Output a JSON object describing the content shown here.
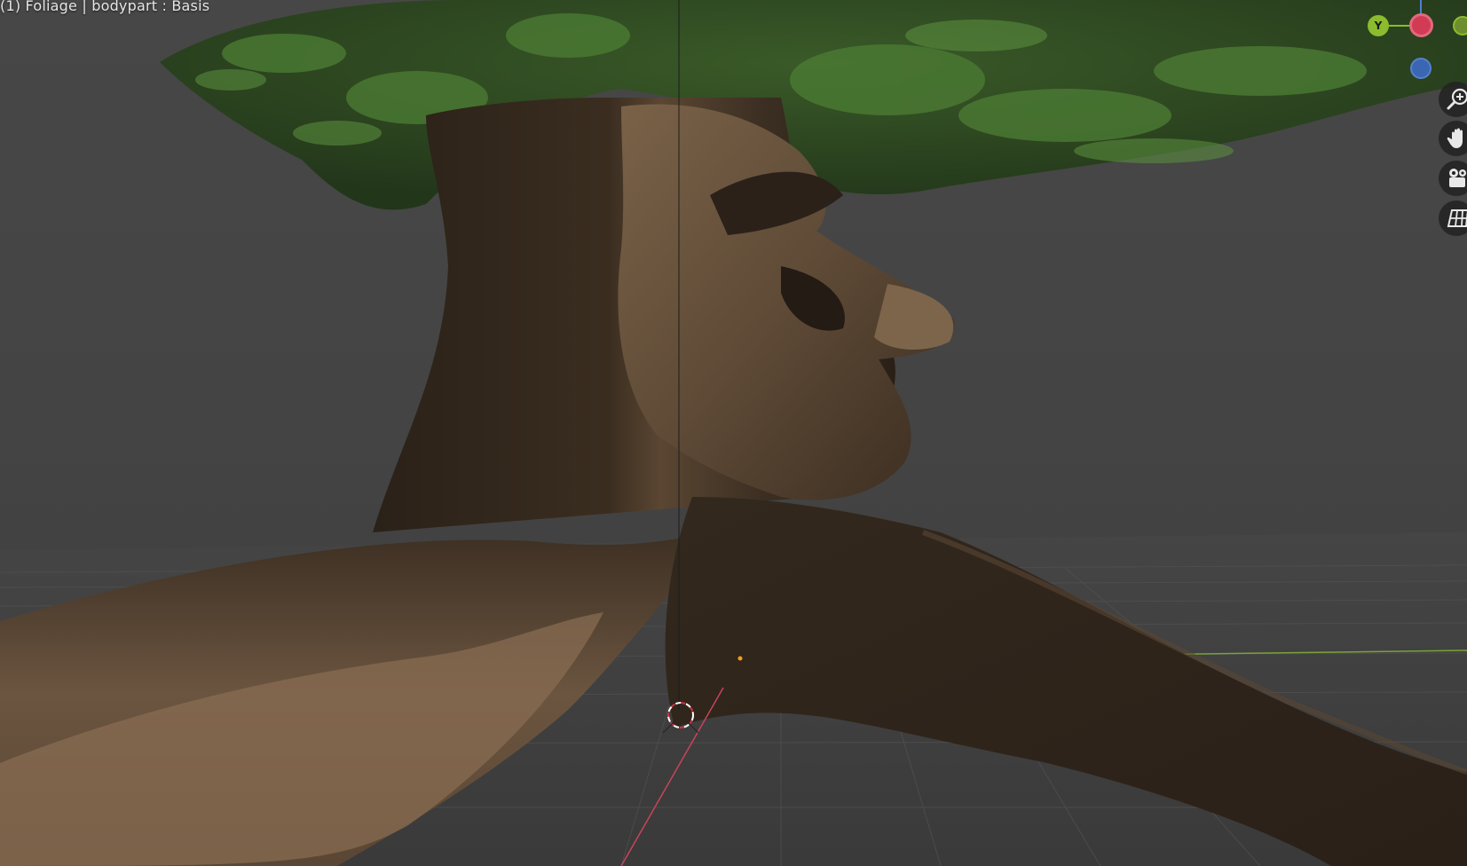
{
  "viewport": {
    "label": "(1) Foliage | bodypart : Basis"
  },
  "gizmo": {
    "y_axis_label": "Y",
    "colors": {
      "x": "#d23b54",
      "y": "#8bbc2e",
      "z": "#3a66b3"
    }
  },
  "nav_buttons": [
    {
      "name": "zoom",
      "icon": "zoom-in-icon"
    },
    {
      "name": "pan",
      "icon": "hand-icon"
    },
    {
      "name": "camera",
      "icon": "camera-icon"
    },
    {
      "name": "perspective-ortho",
      "icon": "grid-icon"
    }
  ]
}
